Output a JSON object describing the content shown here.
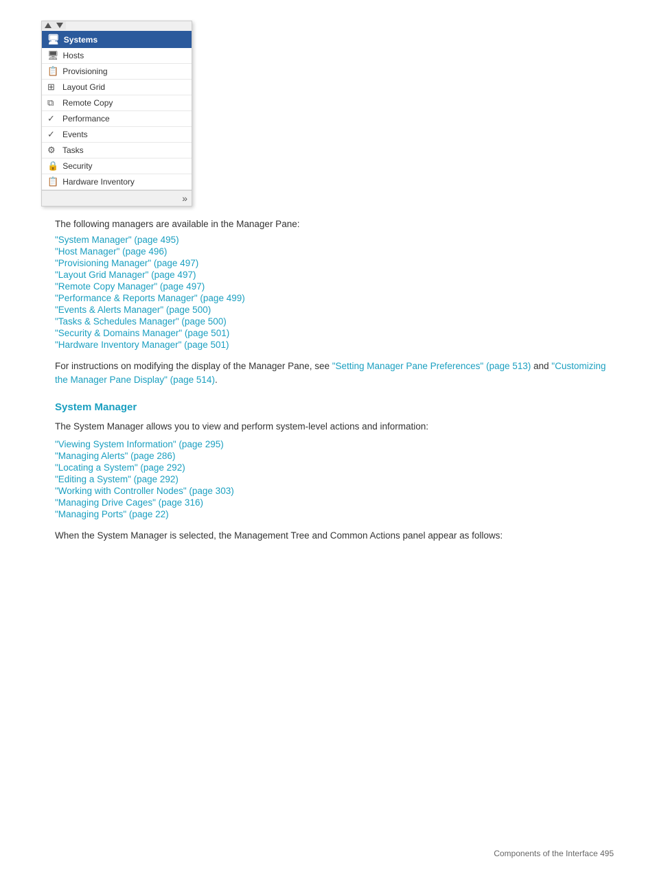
{
  "pane": {
    "header": {
      "label": "Systems",
      "icon": "🖥"
    },
    "items": [
      {
        "label": "Hosts",
        "icon": "🖥",
        "unicode": "🖥"
      },
      {
        "label": "Provisioning",
        "icon": "📋",
        "unicode": "📋"
      },
      {
        "label": "Layout Grid",
        "icon": "⊞",
        "unicode": "⊞"
      },
      {
        "label": "Remote Copy",
        "icon": "⧉",
        "unicode": "⧉"
      },
      {
        "label": "Performance",
        "icon": "✓",
        "unicode": "✓"
      },
      {
        "label": "Events",
        "icon": "✓",
        "unicode": "✓"
      },
      {
        "label": "Tasks",
        "icon": "⚙",
        "unicode": "⚙"
      },
      {
        "label": "Security",
        "icon": "🔒",
        "unicode": "🔒"
      },
      {
        "label": "Hardware Inventory",
        "icon": "📋",
        "unicode": "📋"
      }
    ]
  },
  "content": {
    "intro": "The following managers are available in the Manager Pane:",
    "links": [
      {
        "text": "\"System Manager\" (page 495)"
      },
      {
        "text": "\"Host Manager\" (page 496)"
      },
      {
        "text": "\"Provisioning Manager\" (page 497)"
      },
      {
        "text": "\"Layout Grid Manager\" (page 497)"
      },
      {
        "text": "\"Remote Copy Manager\" (page 497)"
      },
      {
        "text": "\"Performance & Reports Manager\" (page 499)"
      },
      {
        "text": "\"Events & Alerts Manager\" (page 500)"
      },
      {
        "text": "\"Tasks & Schedules Manager\" (page 500)"
      },
      {
        "text": "\"Security & Domains Manager\" (page 501)"
      },
      {
        "text": "\"Hardware Inventory Manager\" (page 501)"
      }
    ],
    "instructions_prefix": "For instructions on modifying the display of the Manager Pane, see ",
    "instructions_link1": "\"Setting Manager Pane Preferences\" (page 513)",
    "instructions_middle": " and ",
    "instructions_link2": "\"Customizing the Manager Pane Display\" (page 514)",
    "instructions_suffix": ".",
    "section_heading": "System Manager",
    "section_intro": "The System Manager allows you to view and perform system-level actions and information:",
    "section_links": [
      {
        "text": "\"Viewing System Information\" (page 295)"
      },
      {
        "text": "\"Managing Alerts\" (page 286)"
      },
      {
        "text": "\"Locating a System\" (page 292)"
      },
      {
        "text": "\"Editing a System\" (page 292)"
      },
      {
        "text": "\"Working with Controller Nodes\" (page 303)"
      },
      {
        "text": "\"Managing Drive Cages\" (page 316)"
      },
      {
        "text": "\"Managing Ports\" (page 22)"
      }
    ],
    "section_closing": "When the System Manager is selected, the Management Tree and Common Actions panel appear as follows:"
  },
  "footer": {
    "text": "Components of the Interface   495"
  }
}
